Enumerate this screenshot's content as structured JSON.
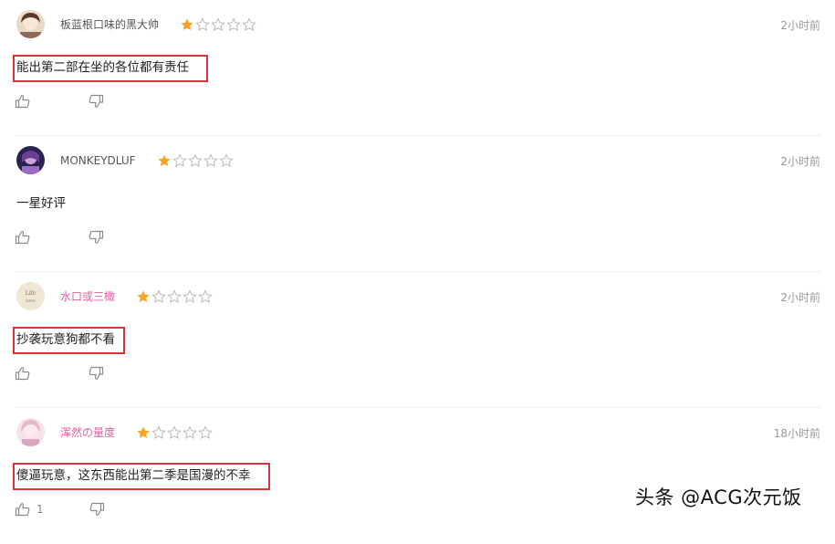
{
  "comments": [
    {
      "username": "板蓝根口味的黑大帅",
      "username_color": "#555555",
      "rating": 1,
      "max_rating": 5,
      "time": "2小时前",
      "content": "能出第二部在坐的各位都有责任",
      "highlighted": true,
      "like_count": ""
    },
    {
      "username": "MONKEYDLUF",
      "username_color": "#555555",
      "rating": 1,
      "max_rating": 5,
      "time": "2小时前",
      "content": "一星好评",
      "highlighted": false,
      "like_count": ""
    },
    {
      "username": "水口或三橄",
      "username_color": "#e0609f",
      "rating": 1,
      "max_rating": 5,
      "time": "2小时前",
      "content": "抄袭玩意狗都不看",
      "highlighted": true,
      "like_count": ""
    },
    {
      "username": "浑然の量度",
      "username_color": "#e0609f",
      "rating": 1,
      "max_rating": 5,
      "time": "18小时前",
      "content": "傻逼玩意，这东西能出第二季是国漫的不幸",
      "highlighted": true,
      "like_count": "1"
    }
  ],
  "icons": {
    "like": "thumbs-up-icon",
    "dislike": "thumbs-down-icon",
    "star_filled": "star-filled-icon",
    "star_empty": "star-outline-icon"
  },
  "colors": {
    "star_filled": "#f5a623",
    "star_empty": "#bbbbbb",
    "highlight_box": "#d9343a"
  },
  "watermark": "头条 @ACG次元饭"
}
